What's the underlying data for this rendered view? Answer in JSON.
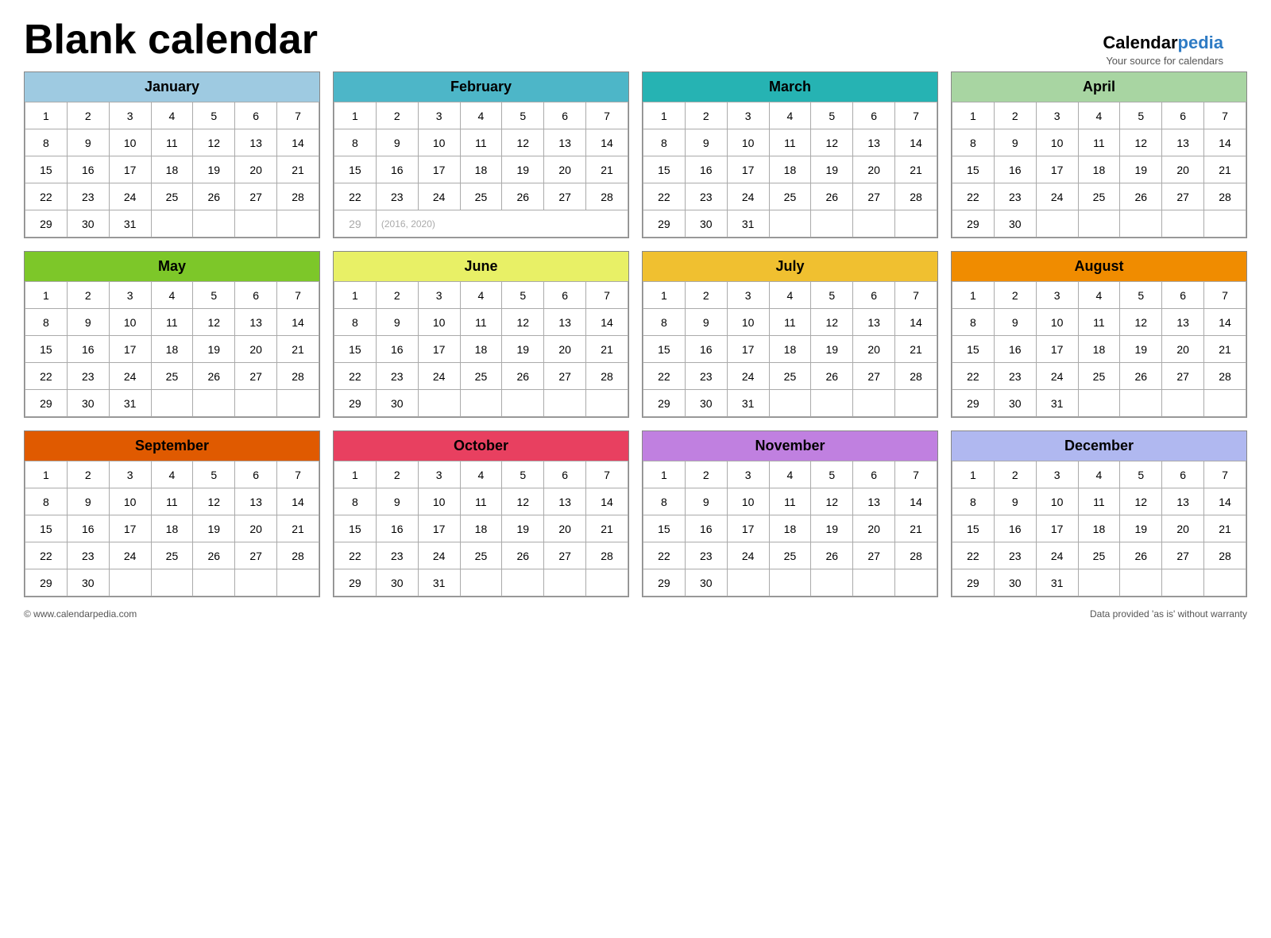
{
  "title": "Blank calendar",
  "logo": {
    "calendar": "Calendar",
    "pedia": "pedia",
    "subtitle": "Your source for calendars"
  },
  "footer": {
    "left": "© www.calendarpedia.com",
    "right": "Data provided 'as is' without warranty"
  },
  "months": [
    {
      "name": "January",
      "headerClass": "hdr-jan",
      "weeks": [
        [
          1,
          2,
          3,
          4,
          5,
          6,
          7
        ],
        [
          8,
          9,
          10,
          11,
          12,
          13,
          14
        ],
        [
          15,
          16,
          17,
          18,
          19,
          20,
          21
        ],
        [
          22,
          23,
          24,
          25,
          26,
          27,
          28
        ],
        [
          29,
          30,
          31,
          null,
          null,
          null,
          null
        ]
      ],
      "extraRow": null
    },
    {
      "name": "February",
      "headerClass": "hdr-feb",
      "weeks": [
        [
          1,
          2,
          3,
          4,
          5,
          6,
          7
        ],
        [
          8,
          9,
          10,
          11,
          12,
          13,
          14
        ],
        [
          15,
          16,
          17,
          18,
          19,
          20,
          21
        ],
        [
          22,
          23,
          24,
          25,
          26,
          27,
          28
        ]
      ],
      "extraRow": {
        "day": 29,
        "note": "(2016, 2020)"
      }
    },
    {
      "name": "March",
      "headerClass": "hdr-mar",
      "weeks": [
        [
          1,
          2,
          3,
          4,
          5,
          6,
          7
        ],
        [
          8,
          9,
          10,
          11,
          12,
          13,
          14
        ],
        [
          15,
          16,
          17,
          18,
          19,
          20,
          21
        ],
        [
          22,
          23,
          24,
          25,
          26,
          27,
          28
        ],
        [
          29,
          30,
          31,
          null,
          null,
          null,
          null
        ]
      ],
      "extraRow": null
    },
    {
      "name": "April",
      "headerClass": "hdr-apr",
      "weeks": [
        [
          1,
          2,
          3,
          4,
          5,
          6,
          7
        ],
        [
          8,
          9,
          10,
          11,
          12,
          13,
          14
        ],
        [
          15,
          16,
          17,
          18,
          19,
          20,
          21
        ],
        [
          22,
          23,
          24,
          25,
          26,
          27,
          28
        ],
        [
          29,
          30,
          null,
          null,
          null,
          null,
          null
        ]
      ],
      "extraRow": null
    },
    {
      "name": "May",
      "headerClass": "hdr-may",
      "weeks": [
        [
          1,
          2,
          3,
          4,
          5,
          6,
          7
        ],
        [
          8,
          9,
          10,
          11,
          12,
          13,
          14
        ],
        [
          15,
          16,
          17,
          18,
          19,
          20,
          21
        ],
        [
          22,
          23,
          24,
          25,
          26,
          27,
          28
        ],
        [
          29,
          30,
          31,
          null,
          null,
          null,
          null
        ]
      ],
      "extraRow": null
    },
    {
      "name": "June",
      "headerClass": "hdr-jun",
      "weeks": [
        [
          1,
          2,
          3,
          4,
          5,
          6,
          7
        ],
        [
          8,
          9,
          10,
          11,
          12,
          13,
          14
        ],
        [
          15,
          16,
          17,
          18,
          19,
          20,
          21
        ],
        [
          22,
          23,
          24,
          25,
          26,
          27,
          28
        ],
        [
          29,
          30,
          null,
          null,
          null,
          null,
          null
        ]
      ],
      "extraRow": null
    },
    {
      "name": "July",
      "headerClass": "hdr-jul",
      "weeks": [
        [
          1,
          2,
          3,
          4,
          5,
          6,
          7
        ],
        [
          8,
          9,
          10,
          11,
          12,
          13,
          14
        ],
        [
          15,
          16,
          17,
          18,
          19,
          20,
          21
        ],
        [
          22,
          23,
          24,
          25,
          26,
          27,
          28
        ],
        [
          29,
          30,
          31,
          null,
          null,
          null,
          null
        ]
      ],
      "extraRow": null
    },
    {
      "name": "August",
      "headerClass": "hdr-aug",
      "weeks": [
        [
          1,
          2,
          3,
          4,
          5,
          6,
          7
        ],
        [
          8,
          9,
          10,
          11,
          12,
          13,
          14
        ],
        [
          15,
          16,
          17,
          18,
          19,
          20,
          21
        ],
        [
          22,
          23,
          24,
          25,
          26,
          27,
          28
        ],
        [
          29,
          30,
          31,
          null,
          null,
          null,
          null
        ]
      ],
      "extraRow": null
    },
    {
      "name": "September",
      "headerClass": "hdr-sep",
      "weeks": [
        [
          1,
          2,
          3,
          4,
          5,
          6,
          7
        ],
        [
          8,
          9,
          10,
          11,
          12,
          13,
          14
        ],
        [
          15,
          16,
          17,
          18,
          19,
          20,
          21
        ],
        [
          22,
          23,
          24,
          25,
          26,
          27,
          28
        ],
        [
          29,
          30,
          null,
          null,
          null,
          null,
          null
        ]
      ],
      "extraRow": null
    },
    {
      "name": "October",
      "headerClass": "hdr-oct",
      "weeks": [
        [
          1,
          2,
          3,
          4,
          5,
          6,
          7
        ],
        [
          8,
          9,
          10,
          11,
          12,
          13,
          14
        ],
        [
          15,
          16,
          17,
          18,
          19,
          20,
          21
        ],
        [
          22,
          23,
          24,
          25,
          26,
          27,
          28
        ],
        [
          29,
          30,
          31,
          null,
          null,
          null,
          null
        ]
      ],
      "extraRow": null
    },
    {
      "name": "November",
      "headerClass": "hdr-nov",
      "weeks": [
        [
          1,
          2,
          3,
          4,
          5,
          6,
          7
        ],
        [
          8,
          9,
          10,
          11,
          12,
          13,
          14
        ],
        [
          15,
          16,
          17,
          18,
          19,
          20,
          21
        ],
        [
          22,
          23,
          24,
          25,
          26,
          27,
          28
        ],
        [
          29,
          30,
          null,
          null,
          null,
          null,
          null
        ]
      ],
      "extraRow": null
    },
    {
      "name": "December",
      "headerClass": "hdr-dec",
      "weeks": [
        [
          1,
          2,
          3,
          4,
          5,
          6,
          7
        ],
        [
          8,
          9,
          10,
          11,
          12,
          13,
          14
        ],
        [
          15,
          16,
          17,
          18,
          19,
          20,
          21
        ],
        [
          22,
          23,
          24,
          25,
          26,
          27,
          28
        ],
        [
          29,
          30,
          31,
          null,
          null,
          null,
          null
        ]
      ],
      "extraRow": null
    }
  ]
}
